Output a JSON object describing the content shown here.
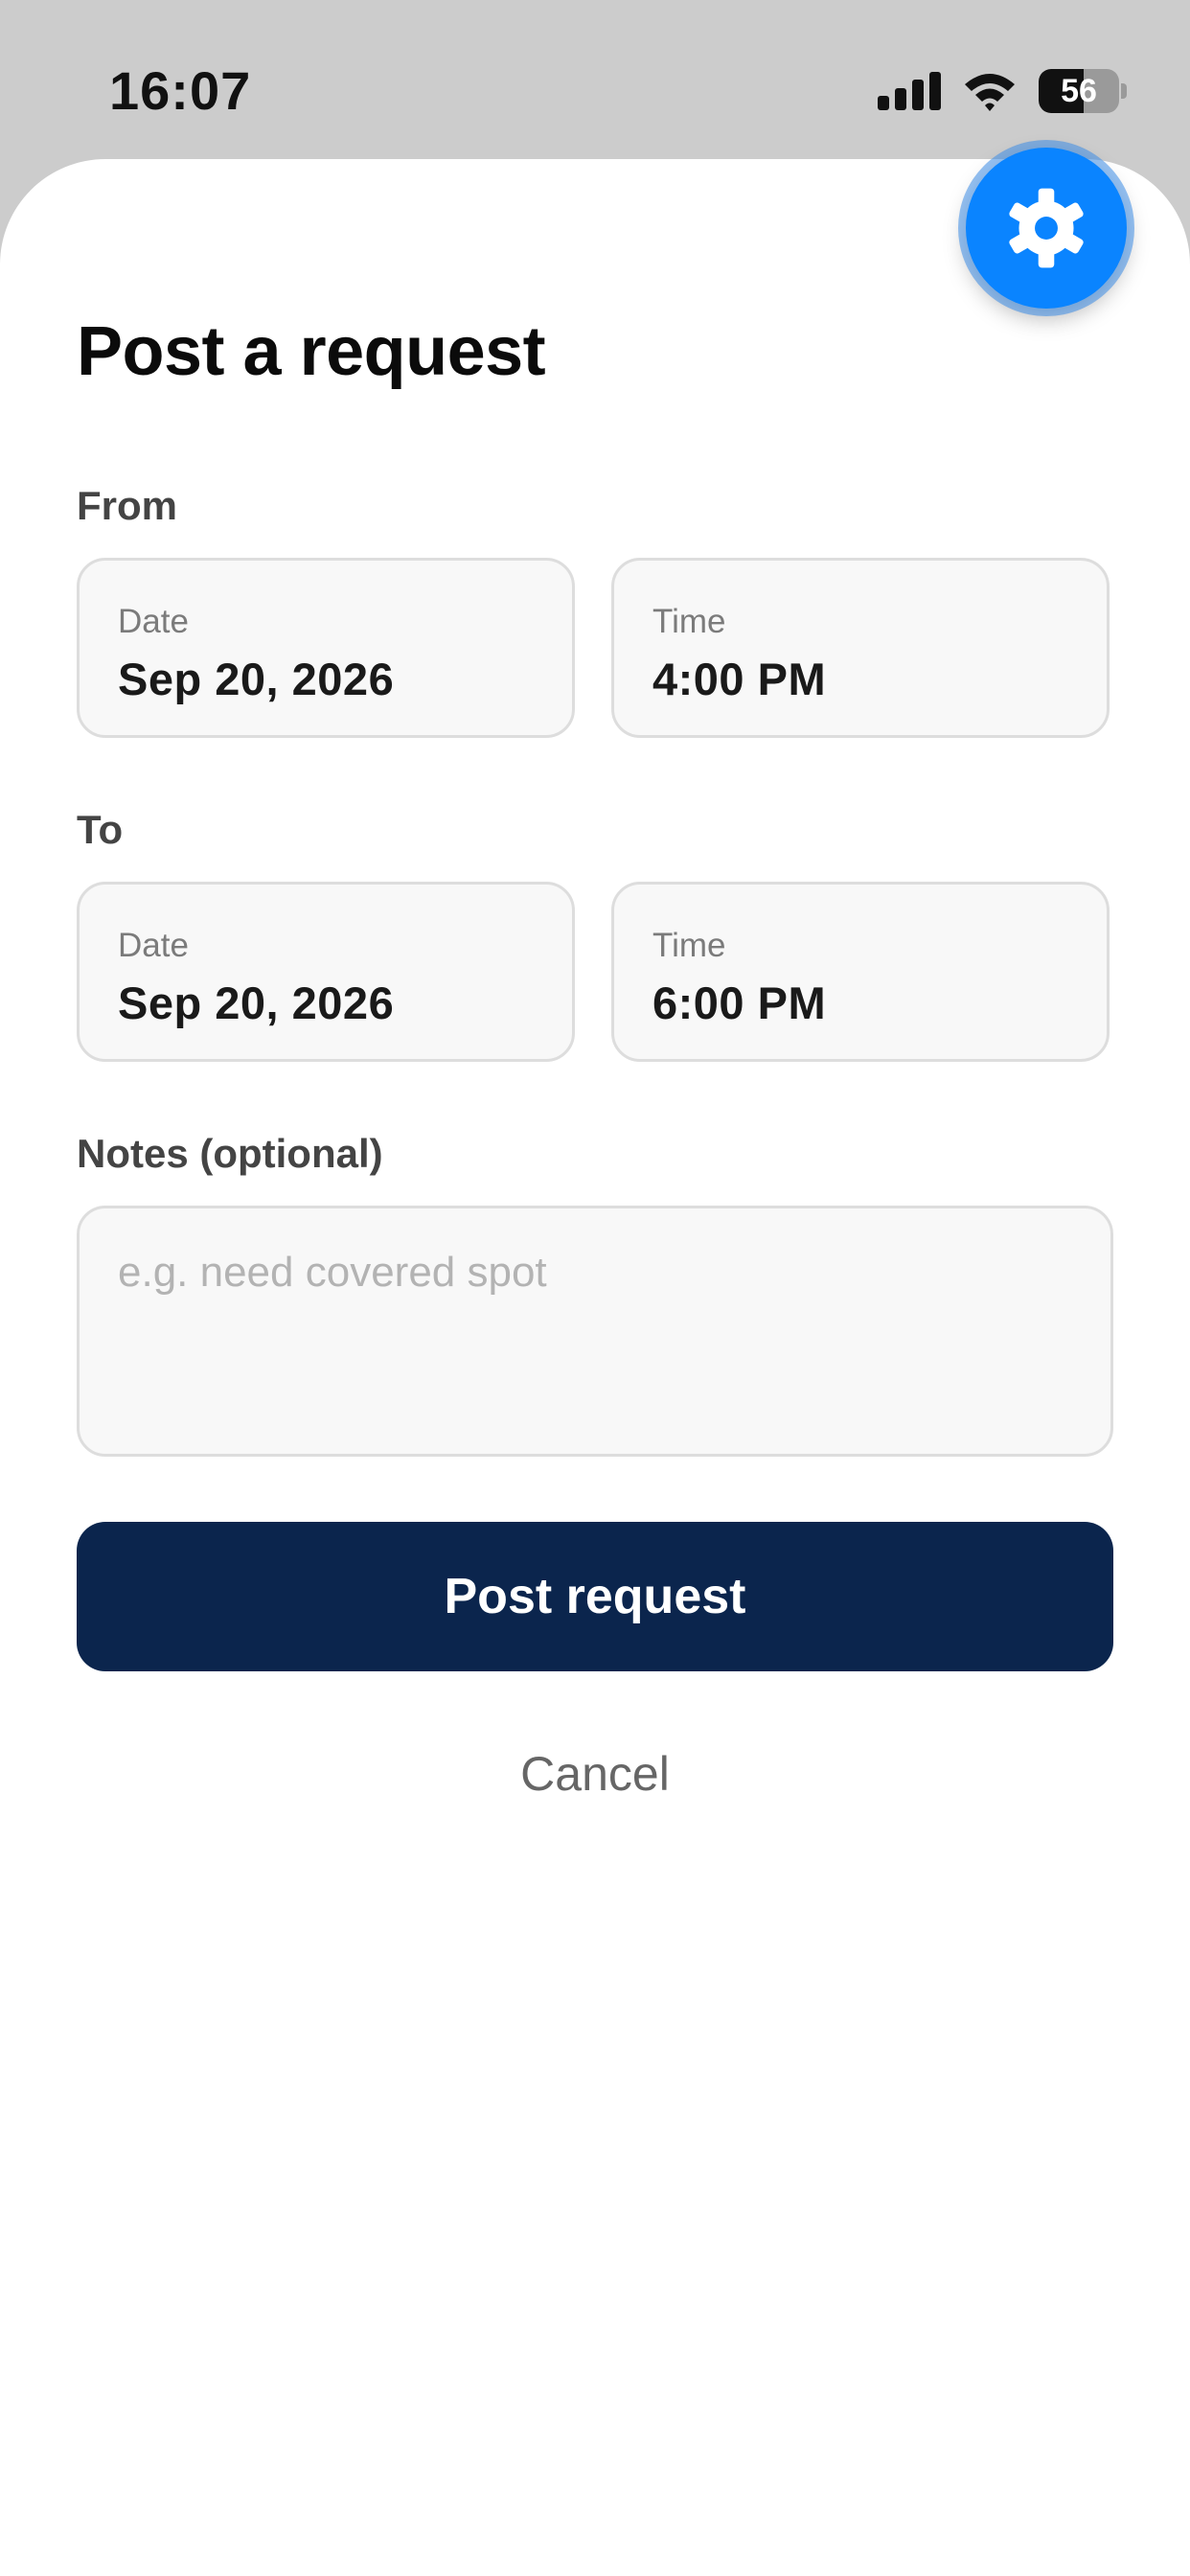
{
  "status_bar": {
    "time": "16:07",
    "battery_level": "56",
    "battery_fraction": 0.56,
    "icons": [
      "cellular-signal-icon",
      "wifi-icon",
      "battery-icon"
    ]
  },
  "settings_fab": {
    "icon": "gear-icon",
    "color": "#0a84ff"
  },
  "title": "Post a request",
  "from": {
    "label": "From",
    "date_caption": "Date",
    "date_value": "Sep 20, 2026",
    "time_caption": "Time",
    "time_value": "4:00 PM"
  },
  "to": {
    "label": "To",
    "date_caption": "Date",
    "date_value": "Sep 20, 2026",
    "time_caption": "Time",
    "time_value": "6:00 PM"
  },
  "notes": {
    "label": "Notes (optional)",
    "placeholder": "e.g. need covered spot",
    "value": ""
  },
  "primary_button": {
    "label": "Post request",
    "color": "#0b254d"
  },
  "cancel_label": "Cancel"
}
